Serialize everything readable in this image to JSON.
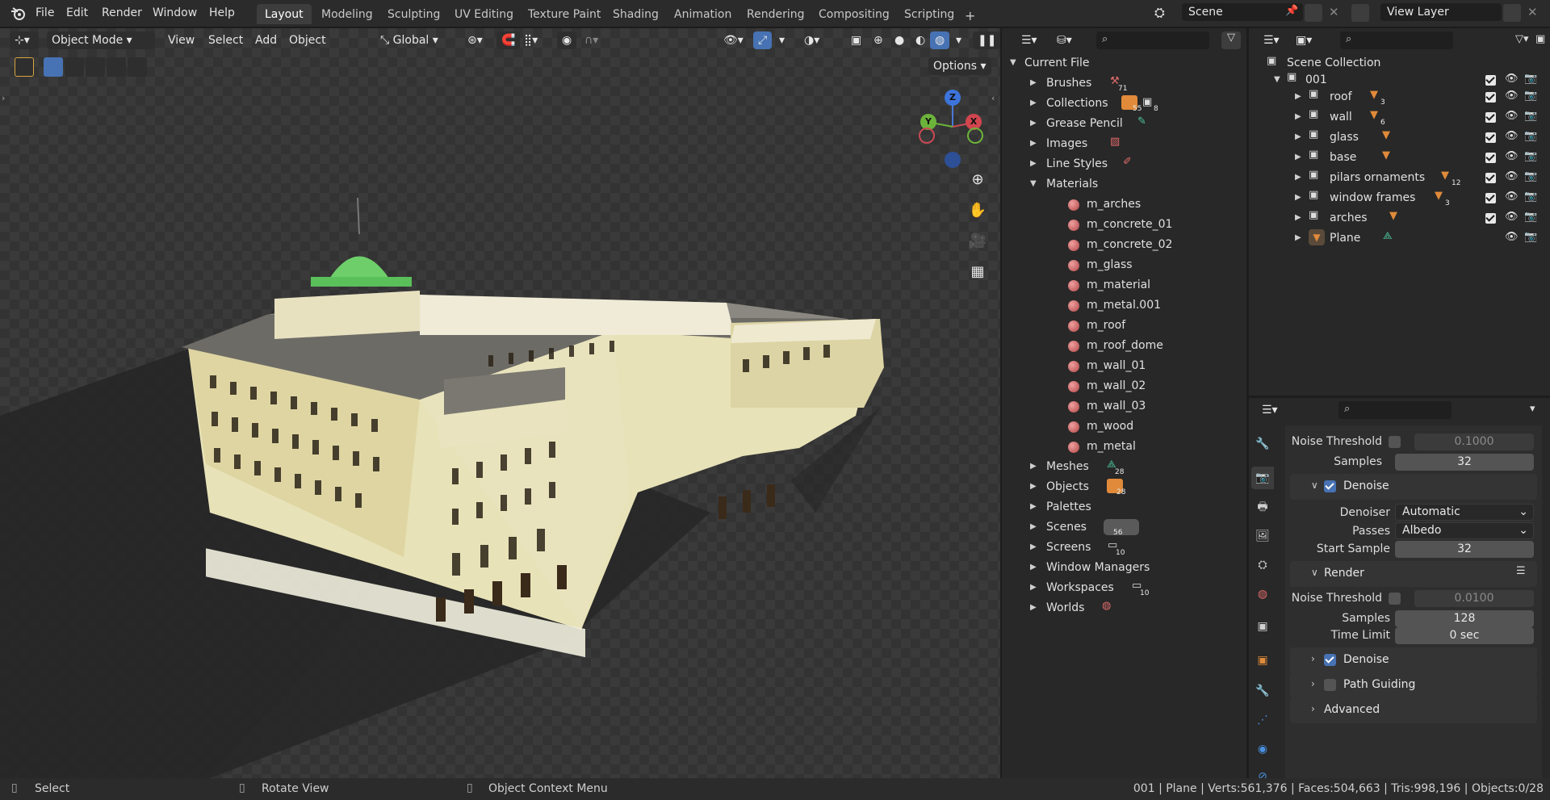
{
  "app": {
    "logo": "blender-logo-icon",
    "menus": [
      "File",
      "Edit",
      "Render",
      "Window",
      "Help"
    ],
    "workspaces": [
      "Layout",
      "Modeling",
      "Sculpting",
      "UV Editing",
      "Texture Paint",
      "Shading",
      "Animation",
      "Rendering",
      "Compositing",
      "Scripting"
    ],
    "active_workspace": "Layout",
    "add_workspace": "+",
    "scene_name": "Scene",
    "view_layer": "View Layer"
  },
  "viewport": {
    "mode": "Object Mode",
    "menus": [
      "View",
      "Select",
      "Add",
      "Object"
    ],
    "transform_orientation": "Global",
    "options_label": "Options",
    "gizmo": {
      "z": "Z",
      "y": "Y",
      "x": "X"
    },
    "nav_icons": [
      "zoom-icon",
      "hand-pan-icon",
      "camera-icon",
      "grid-icon"
    ]
  },
  "data_browser": {
    "root": "Current File",
    "items": [
      {
        "label": "Brushes",
        "badge": "71"
      },
      {
        "label": "Collections",
        "badge": "55",
        "badge2": "8"
      },
      {
        "label": "Grease Pencil",
        "badge": ""
      },
      {
        "label": "Images",
        "badge": ""
      },
      {
        "label": "Line Styles",
        "badge": ""
      },
      {
        "label": "Materials",
        "badge": "",
        "expanded": true
      },
      {
        "label": "Meshes",
        "badge": "28"
      },
      {
        "label": "Objects",
        "badge": "28"
      },
      {
        "label": "Palettes",
        "badge": ""
      },
      {
        "label": "Scenes",
        "badge": "56"
      },
      {
        "label": "Screens",
        "badge": "10"
      },
      {
        "label": "Window Managers",
        "badge": ""
      },
      {
        "label": "Workspaces",
        "badge": "10"
      },
      {
        "label": "Worlds",
        "badge": ""
      }
    ],
    "materials": [
      "m_arches",
      "m_concrete_01",
      "m_concrete_02",
      "m_glass",
      "m_material",
      "m_metal.001",
      "m_roof",
      "m_roof_dome",
      "m_wall_01",
      "m_wall_02",
      "m_wall_03",
      "m_wood",
      "m_metal"
    ]
  },
  "outliner": {
    "root": "Scene Collection",
    "collection": "001",
    "children": [
      {
        "label": "roof",
        "badge": "3",
        "checked": true
      },
      {
        "label": "wall",
        "badge": "6",
        "checked": true
      },
      {
        "label": "glass",
        "badge": "",
        "checked": true
      },
      {
        "label": "base",
        "badge": "",
        "checked": true
      },
      {
        "label": "pilars ornaments",
        "badge": "12",
        "checked": true
      },
      {
        "label": "window frames",
        "badge": "3",
        "checked": true
      },
      {
        "label": "arches",
        "badge": "",
        "checked": true
      },
      {
        "label": "Plane",
        "badge": "",
        "checked": false
      }
    ]
  },
  "properties": {
    "viewport_noise_threshold_label": "Noise Threshold",
    "viewport_noise_threshold": "0.1000",
    "viewport_samples_label": "Samples",
    "viewport_samples": "32",
    "denoise_label": "Denoise",
    "denoiser_label": "Denoiser",
    "denoiser": "Automatic",
    "passes_label": "Passes",
    "passes": "Albedo",
    "start_sample_label": "Start Sample",
    "start_sample": "32",
    "render_section": "Render",
    "render_noise_threshold_label": "Noise Threshold",
    "render_noise_threshold": "0.0100",
    "render_samples_label": "Samples",
    "render_samples": "128",
    "time_limit_label": "Time Limit",
    "time_limit": "0 sec",
    "render_denoise_label": "Denoise",
    "path_guiding_label": "Path Guiding",
    "advanced_label": "Advanced"
  },
  "statusbar": {
    "select": "Select",
    "rotate": "Rotate View",
    "context": "Object Context Menu",
    "stats": "001 | Plane | Verts:561,376 | Faces:504,663 | Tris:998,196 | Objects:0/28"
  }
}
